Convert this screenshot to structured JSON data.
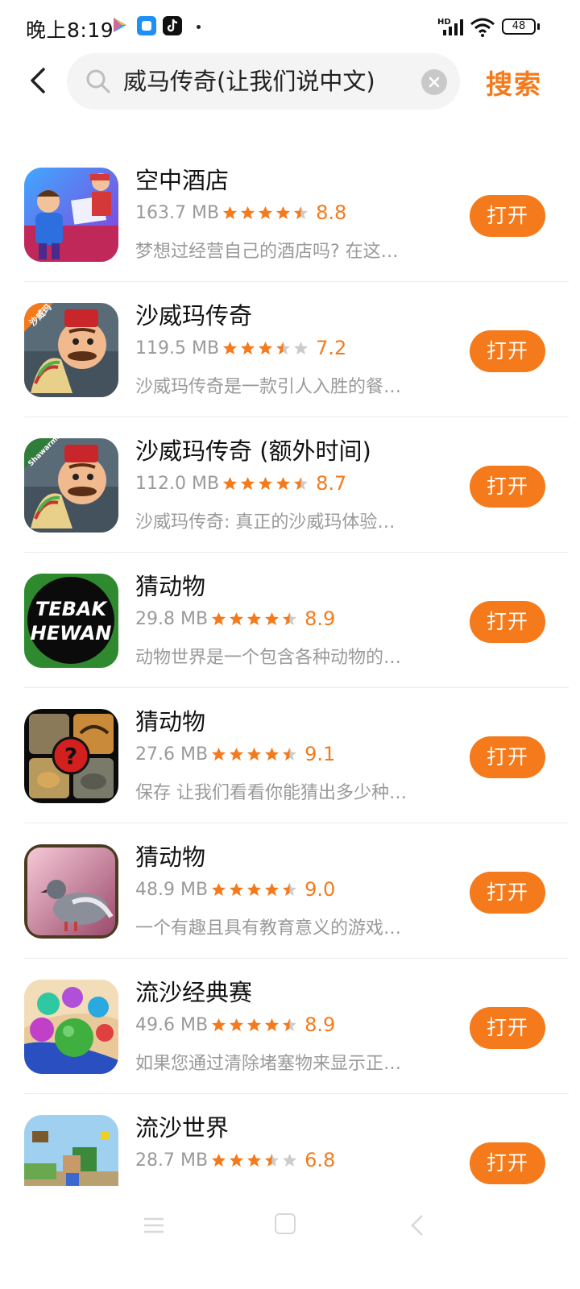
{
  "status_bar": {
    "time": "晚上8:19",
    "network": "HD",
    "battery": "48"
  },
  "search": {
    "query": "威马传奇(让我们说中文)",
    "button": "搜索"
  },
  "apps": [
    {
      "name": "空中酒店",
      "size": "163.7 MB",
      "rating": "8.8",
      "stars": 4.5,
      "description": "梦想过经营自己的酒店吗? 在这…",
      "action": "打开",
      "icon": "hotel-game-icon"
    },
    {
      "name": "沙威玛传奇",
      "size": "119.5 MB",
      "rating": "7.2",
      "stars": 3.5,
      "description": "沙威玛传奇是一款引人入胜的餐…",
      "action": "打开",
      "icon": "shawarma-legend-icon",
      "icon_label": "沙威玛"
    },
    {
      "name": "沙威玛传奇 (额外时间)",
      "size": "112.0 MB",
      "rating": "8.7",
      "stars": 4.5,
      "description": " 沙威玛传奇: 真正的沙威玛体验…",
      "action": "打开",
      "icon": "shawarma-extra-icon",
      "icon_label": "Shawarma"
    },
    {
      "name": "猜动物",
      "size": "29.8 MB",
      "rating": "8.9",
      "stars": 4.5,
      "description": "动物世界是一个包含各种动物的…",
      "action": "打开",
      "icon": "tebak-hewan-icon",
      "icon_label_1": "TEBAK",
      "icon_label_2": "HEWAN"
    },
    {
      "name": "猜动物",
      "size": "27.6 MB",
      "rating": "9.1",
      "stars": 4.5,
      "description": "保存 让我们看看你能猜出多少种…",
      "action": "打开",
      "icon": "animal-quiz-icon",
      "icon_label": "?"
    },
    {
      "name": "猜动物",
      "size": "48.9 MB",
      "rating": "9.0",
      "stars": 4.5,
      "description": "一个有趣且具有教育意义的游戏…",
      "action": "打开",
      "icon": "pigeon-icon"
    },
    {
      "name": "流沙经典赛",
      "size": "49.6 MB",
      "rating": "8.9",
      "stars": 4.5,
      "description": "如果您通过清除堵塞物来显示正…",
      "action": "打开",
      "icon": "sand-balls-icon"
    },
    {
      "name": "流沙世界",
      "size": "28.7 MB",
      "rating": "6.8",
      "stars": 3.5,
      "description": "",
      "action": "打开",
      "icon": "sand-world-icon"
    }
  ],
  "colors": {
    "accent": "#f47a1b",
    "star_filled": "#f47a1b",
    "star_empty": "#cccccc",
    "text_secondary": "#9a9a9a"
  }
}
